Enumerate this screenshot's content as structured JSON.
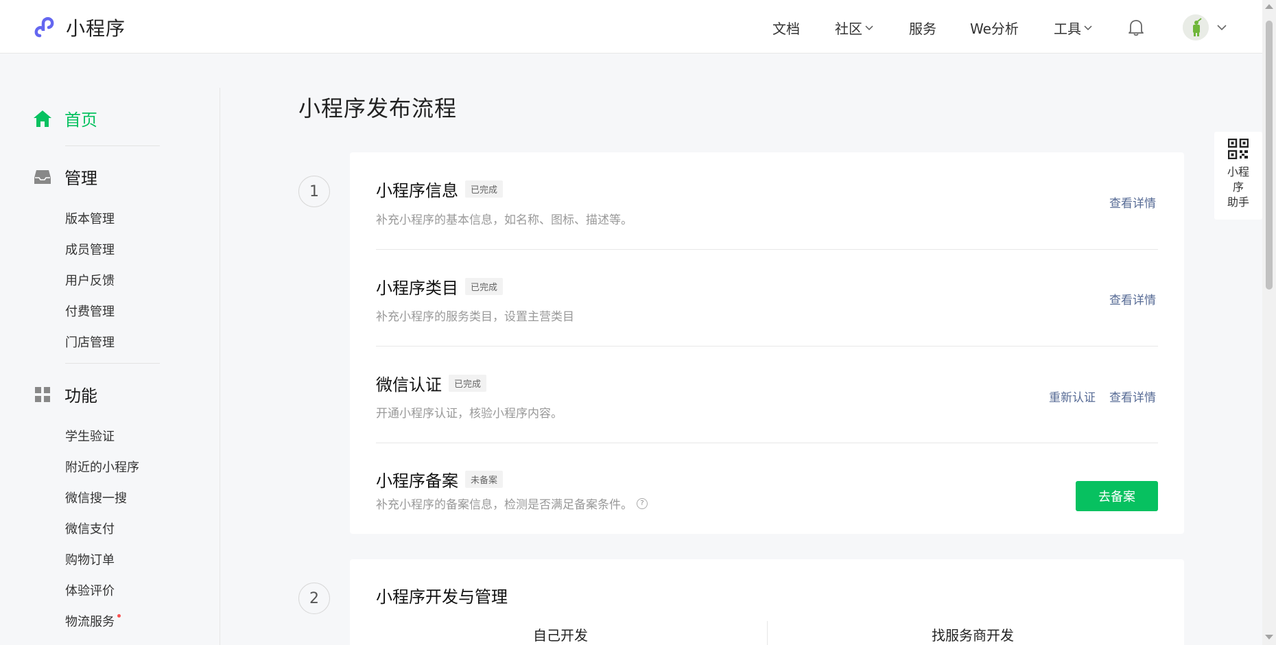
{
  "header": {
    "logo_text": "小程序",
    "nav": [
      {
        "label": "文档",
        "has_dropdown": false
      },
      {
        "label": "社区",
        "has_dropdown": true
      },
      {
        "label": "服务",
        "has_dropdown": false
      },
      {
        "label": "We分析",
        "has_dropdown": false
      },
      {
        "label": "工具",
        "has_dropdown": true
      }
    ],
    "bell_icon": "bell-icon",
    "avatar_icon": "avatar-icon"
  },
  "sidebar": {
    "sections": [
      {
        "title": "首页",
        "icon": "home-icon",
        "active": true,
        "items": []
      },
      {
        "title": "管理",
        "icon": "inbox-icon",
        "active": false,
        "items": [
          "版本管理",
          "成员管理",
          "用户反馈",
          "付费管理",
          "门店管理"
        ]
      },
      {
        "title": "功能",
        "icon": "grid-icon",
        "active": false,
        "items": [
          "学生验证",
          "附近的小程序",
          "微信搜一搜",
          "微信支付",
          "购物订单",
          "体验评价",
          "物流服务"
        ]
      }
    ]
  },
  "main": {
    "title": "小程序发布流程",
    "step1": {
      "number": "1",
      "rows": [
        {
          "title": "小程序信息",
          "badge": "已完成",
          "desc": "补充小程序的基本信息，如名称、图标、描述等。",
          "link": "查看详情"
        },
        {
          "title": "小程序类目",
          "badge": "已完成",
          "desc": "补充小程序的服务类目，设置主营类目",
          "link": "查看详情"
        },
        {
          "title": "微信认证",
          "badge": "已完成",
          "desc": "开通小程序认证，核验小程序内容。",
          "link": "查看详情",
          "link2": "重新认证"
        },
        {
          "title": "小程序备案",
          "badge": "未备案",
          "desc": "补充小程序的备案信息，检测是否满足备案条件。",
          "button": "去备案",
          "help": "?"
        }
      ]
    },
    "step2": {
      "number": "2",
      "title": "小程序开发与管理",
      "tabs": [
        "自己开发",
        "找服务商开发"
      ]
    }
  },
  "assistant": {
    "label": "小程序助手",
    "label_lines": [
      "小程",
      "序",
      "助手"
    ],
    "icon": "qrcode-icon"
  },
  "colors": {
    "brand_green": "#07c160",
    "link_blue": "#576b95",
    "logo_purple": "#6467f0",
    "badge_bg": "#f2f2f2"
  }
}
